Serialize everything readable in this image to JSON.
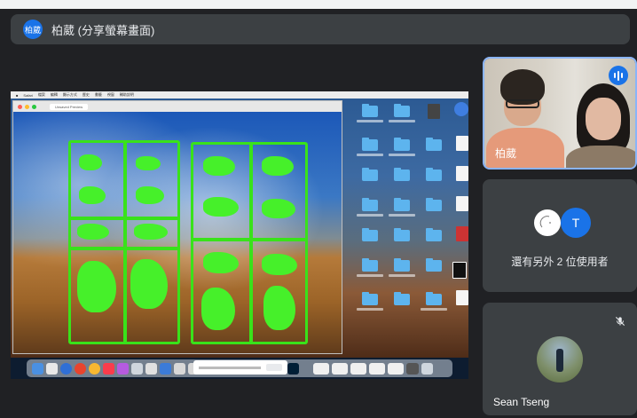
{
  "banner": {
    "avatar_text": "柏葳",
    "title": "柏葳 (分享螢幕畫面)"
  },
  "shared_screen": {
    "menubar_items": [
      "■",
      "Safari",
      "檔案",
      "編輯",
      "顯示方式",
      "歷史",
      "書籤",
      "視窗",
      "輔助說明"
    ],
    "window_tab": "Unsaved Preview"
  },
  "tiles": {
    "self": {
      "name": "柏葳",
      "icon": "speaking-indicator-icon"
    },
    "others": {
      "avatar_letter": "T",
      "text": "還有另外 2 位使用者"
    },
    "sean": {
      "name": "Sean Tseng",
      "icon": "mic-off-icon"
    }
  },
  "colors": {
    "background": "#202124",
    "tile": "#3c4043",
    "accent": "#1a73e8",
    "active_border": "#8ab4f8",
    "sprue_green": "#39e21a"
  }
}
